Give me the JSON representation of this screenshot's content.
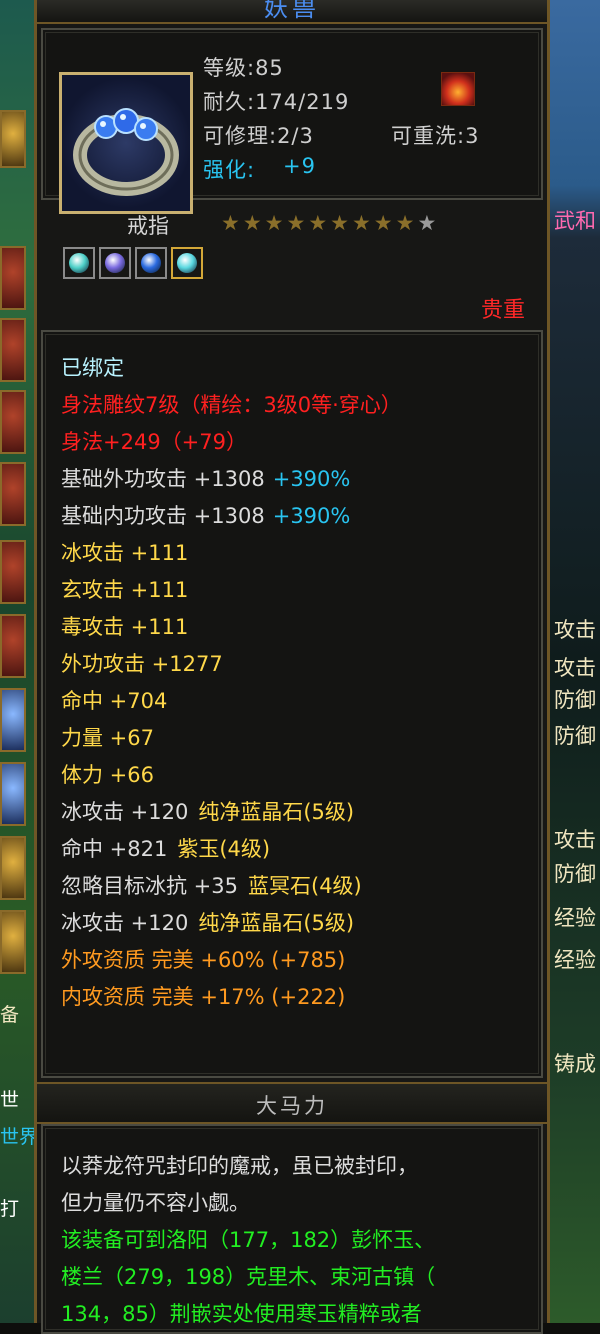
{
  "window": {
    "title": "妖兽"
  },
  "item": {
    "icon_name": "ring-with-blue-gems-icon",
    "level_label": "等级:85",
    "durability_label": "耐久:174/219",
    "repairable_label": "可修理:2/3",
    "rewash_label": "可重洗:3",
    "enhance_label": "强化:",
    "enhance_value": "+9",
    "type_label": "戒指",
    "stars": {
      "filled": 9,
      "total": 10
    },
    "rarity": "贵重",
    "gems": [
      {
        "name": "blue-crystal-gem-icon",
        "color": "#4ed0c8"
      },
      {
        "name": "purple-jade-gem-icon",
        "color": "#7a6ae0"
      },
      {
        "name": "blue-stone-gem-icon",
        "color": "#2a6ae0"
      },
      {
        "name": "blue-crystal-gem-icon",
        "color": "#5ad8e0"
      }
    ]
  },
  "attributes": [
    {
      "text": "已绑定",
      "color": "#b9f3ff"
    },
    {
      "text": "身法雕纹7级（精绘：3级0等·穿心）",
      "color": "#ff2020"
    },
    {
      "text": "身法+249（+79）",
      "color": "#ff2020"
    },
    {
      "text": "基础外功攻击 +1308",
      "extra": "+390%",
      "color": "#dcdcdc"
    },
    {
      "text": "基础内功攻击 +1308",
      "extra": "+390%",
      "color": "#dcdcdc"
    },
    {
      "text": "冰攻击 +111",
      "color": "#ffd84a"
    },
    {
      "text": "玄攻击 +111",
      "color": "#ffd84a"
    },
    {
      "text": "毒攻击 +111",
      "color": "#ffd84a"
    },
    {
      "text": "外功攻击 +1277",
      "color": "#ffd84a"
    },
    {
      "text": "命中 +704",
      "color": "#ffd84a"
    },
    {
      "text": "力量 +67",
      "color": "#ffd84a"
    },
    {
      "text": "体力 +66",
      "color": "#ffd84a"
    },
    {
      "text": "冰攻击 +120",
      "gem": "纯净蓝晶石(5级)",
      "color": "#dcdcdc"
    },
    {
      "text": "命中 +821",
      "gem": "紫玉(4级)",
      "color": "#dcdcdc"
    },
    {
      "text": "忽略目标冰抗 +35",
      "gem": "蓝冥石(4级)",
      "color": "#dcdcdc"
    },
    {
      "text": "冰攻击 +120",
      "gem": "纯净蓝晶石(5级)",
      "color": "#dcdcdc"
    },
    {
      "text": "外攻资质   完美 +60% (+785)",
      "color": "#ff9a20"
    },
    {
      "text": "内攻资质   完美 +17% (+222)",
      "color": "#ff9a20"
    }
  ],
  "set_name": "大马力",
  "description": {
    "line1": "以莽龙符咒封印的魔戒，虽已被封印，",
    "line2": "但力量仍不容小觑。",
    "line3": "该装备可到洛阳（177，182）彭怀玉、",
    "line4": "楼兰（279，198）克里木、束河古镇（",
    "line5": "134，85）荆嵌实处使用寒玉精粹或者"
  },
  "background": {
    "right_texts": [
      "武和",
      "攻击",
      "攻击",
      "防御",
      "防御",
      "攻击",
      "防御",
      "经验",
      "经验",
      "铸成"
    ],
    "left_texts": [
      "备",
      "世",
      "世界",
      "打"
    ]
  }
}
